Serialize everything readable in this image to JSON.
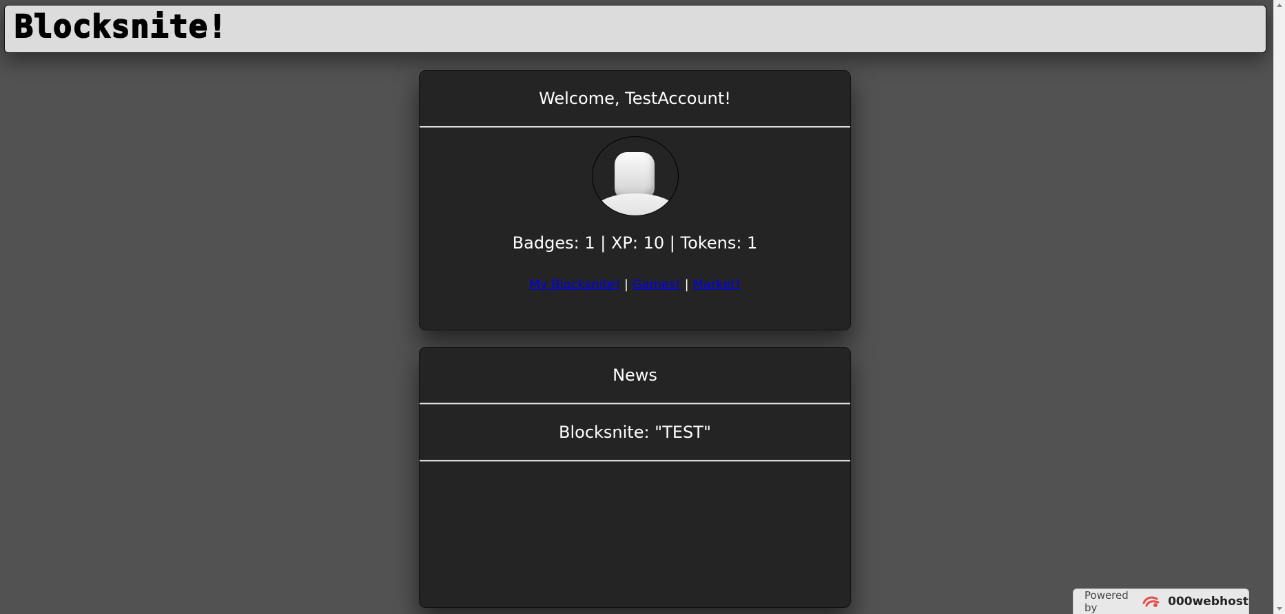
{
  "header": {
    "logo_text": "Blocksnite!"
  },
  "welcome_card": {
    "title": "Welcome, TestAccount!",
    "stats": {
      "badges_label": "Badges:",
      "badges_value": "1",
      "xp_label": "XP:",
      "xp_value": "10",
      "tokens_label": "Tokens:",
      "tokens_value": "1"
    },
    "links": [
      {
        "label": "My Blocksnite!"
      },
      {
        "label": "Games!"
      },
      {
        "label": "Market!"
      }
    ],
    "separator": "|"
  },
  "news_card": {
    "title": "News",
    "items": [
      {
        "text": "Blocksnite: \"TEST\""
      }
    ]
  },
  "footer": {
    "powered_by": "Powered by",
    "brand": "000webhost"
  },
  "colors": {
    "background": "#525252",
    "header_bg": "#dcdcdc",
    "card_bg": "#242424",
    "link": "#0000ee",
    "text": "#ffffff"
  },
  "icons": {
    "avatar": "avatar-figure",
    "host_logo": "000webhost-logo"
  }
}
